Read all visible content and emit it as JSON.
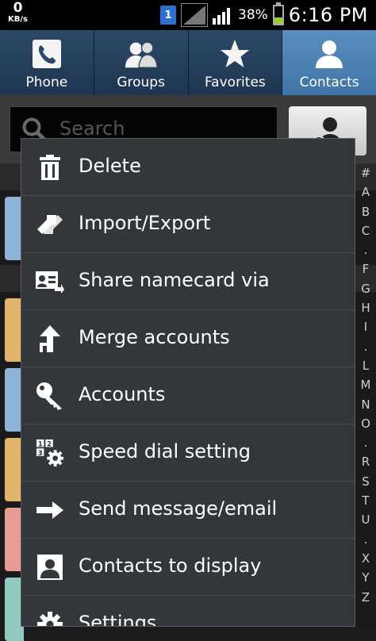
{
  "status_bar": {
    "speed_value": "0",
    "speed_unit": "KB/s",
    "sim_badge": "1",
    "battery_percent": "38%",
    "time": "6:16 PM"
  },
  "tabs": [
    {
      "label": "Phone",
      "icon": "phone-icon",
      "active": false
    },
    {
      "label": "Groups",
      "icon": "groups-icon",
      "active": false
    },
    {
      "label": "Favorites",
      "icon": "star-icon",
      "active": false
    },
    {
      "label": "Contacts",
      "icon": "contact-person-icon",
      "active": true
    }
  ],
  "search": {
    "placeholder": "Search"
  },
  "menu": {
    "items": [
      {
        "label": "Delete",
        "icon": "trash-icon"
      },
      {
        "label": "Import/Export",
        "icon": "import-export-icon"
      },
      {
        "label": "Share namecard via",
        "icon": "namecard-share-icon"
      },
      {
        "label": "Merge accounts",
        "icon": "merge-icon"
      },
      {
        "label": "Accounts",
        "icon": "key-icon"
      },
      {
        "label": "Speed dial setting",
        "icon": "speed-dial-icon"
      },
      {
        "label": "Send message/email",
        "icon": "arrow-right-icon"
      },
      {
        "label": "Contacts to display",
        "icon": "contact-card-icon"
      },
      {
        "label": "Settings",
        "icon": "gear-icon"
      }
    ]
  },
  "index_letters": [
    "#",
    "A",
    "B",
    "C",
    ".",
    "F",
    "G",
    "H",
    "I",
    ".",
    "L",
    "M",
    "N",
    "O",
    ".",
    "R",
    "S",
    "T",
    "U",
    ".",
    "X",
    "Y",
    "Z"
  ],
  "colors": {
    "active_tab": "#4a80b2",
    "battery": "#9acd32",
    "sim": "#2d6fcf"
  }
}
